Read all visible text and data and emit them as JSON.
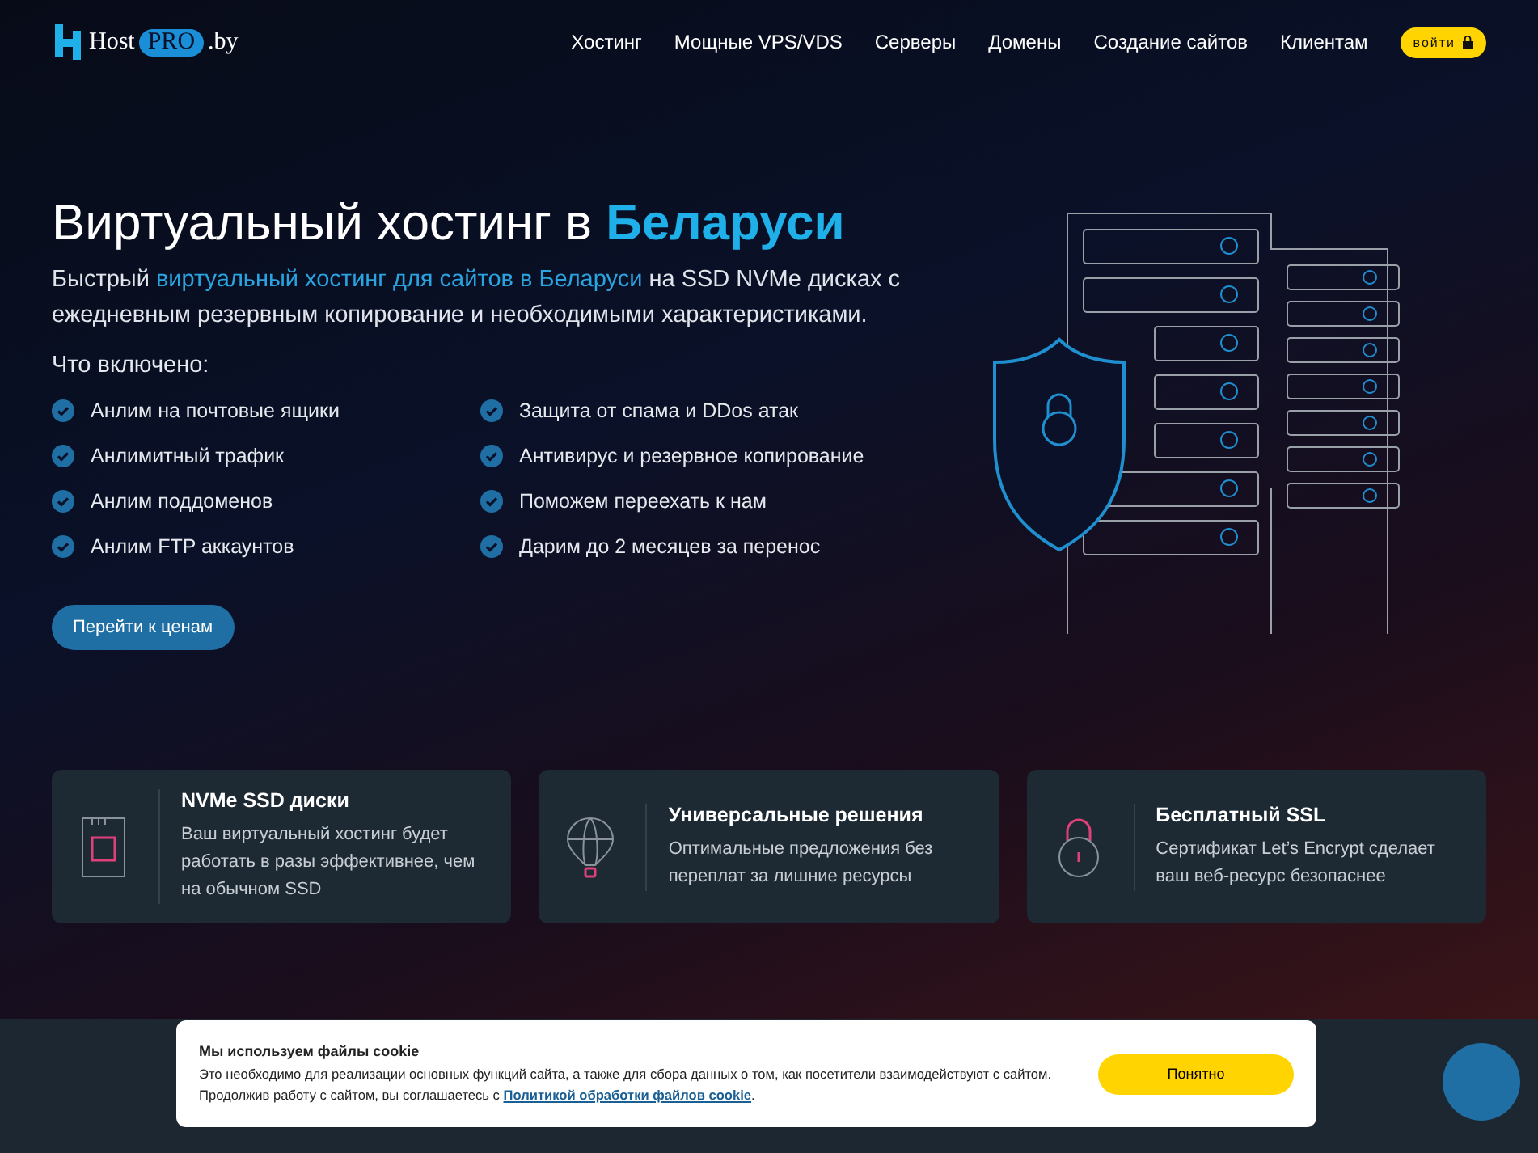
{
  "header": {
    "logo": {
      "name": "Host",
      "badge": "PRO",
      "suffix": ".by"
    },
    "nav": [
      {
        "label": "Хостинг"
      },
      {
        "label": "Мощные VPS/VDS"
      },
      {
        "label": "Серверы"
      },
      {
        "label": "Домены"
      },
      {
        "label": "Создание сайтов"
      },
      {
        "label": "Клиентам"
      }
    ],
    "login": "войти"
  },
  "hero": {
    "title": [
      {
        "text": "Виртуальный хостинг в ",
        "highlight": false
      },
      {
        "text": "Беларуси",
        "highlight": true
      }
    ],
    "subtitle": [
      {
        "text": "Быстрый ",
        "highlight": false
      },
      {
        "text": "виртуальный хостинг для сайтов в Беларуси",
        "highlight": true
      },
      {
        "text": " на SSD NVMe дисках с ежедневным резервным копирование и необходимыми характеристиками.",
        "highlight": false
      }
    ],
    "included_heading": "Что включено:",
    "features": [
      {
        "label": "Анлим на почтовые ящики"
      },
      {
        "label": "Анлимитный трафик"
      },
      {
        "label": "Анлим поддоменов"
      },
      {
        "label": "Анлим FTP аккаунтов"
      },
      {
        "label": "Защита от спама и DDos атак"
      },
      {
        "label": "Антивирус и резервное копирование"
      },
      {
        "label": "Поможем переехать к нам"
      },
      {
        "label": "Дарим до 2 месяцев за перенос"
      }
    ],
    "cta": "Перейти к ценам"
  },
  "cards": [
    {
      "kind": "disk",
      "title": "NVMe SSD диски",
      "text": "Ваш виртуальный хостинг будет работать в разы эффективнее, чем на обычном SSD"
    },
    {
      "kind": "balloon",
      "title": "Универсальные решения",
      "text": "Оптимальные предложения без переплат за лишние ресурсы"
    },
    {
      "kind": "lock",
      "title": "Бесплатный SSL",
      "text": "Сертификат Let’s Encrypt сделает ваш веб-ресурс безопаснее"
    }
  ],
  "cookie": {
    "title": "Мы используем файлы cookie",
    "text": "Это необходимо для реализации основных функций сайта, а также для сбора данных о том, как посетители взаимодействуют с сайтом.",
    "consent_before": "Продолжив работу с сайтом, вы соглашаетесь с ",
    "consent_link": "Политикой обработки файлов cookie",
    "consent_after": ".",
    "button": "Понятно"
  }
}
